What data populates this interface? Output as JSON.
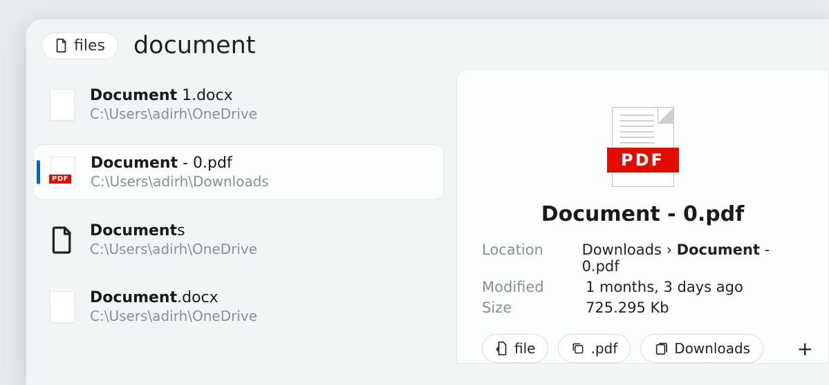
{
  "header": {
    "files_label": "files",
    "search_query": "document"
  },
  "results": [
    {
      "icon": "doc",
      "title_prefix": "Document",
      "title_suffix": " 1.docx",
      "path": "C:\\Users\\adirh\\OneDrive",
      "selected": false
    },
    {
      "icon": "pdf",
      "title_prefix": "Document",
      "title_suffix": " - 0.pdf",
      "path": "C:\\Users\\adirh\\Downloads",
      "selected": true
    },
    {
      "icon": "folder-file",
      "title_prefix": "Document",
      "title_suffix": "s",
      "path": "C:\\Users\\adirh\\OneDrive",
      "selected": false
    },
    {
      "icon": "doc",
      "title_prefix": "Document",
      "title_suffix": ".docx",
      "path": "C:\\Users\\adirh\\OneDrive",
      "selected": false
    }
  ],
  "preview": {
    "filename": "Document - 0.pdf",
    "meta": {
      "location_label": "Location",
      "location_prefix": "Downloads › ",
      "location_bold": "Document",
      "location_suffix": " - 0.pdf",
      "modified_label": "Modified",
      "modified_value": "1 months, 3 days ago",
      "size_label": "Size",
      "size_value": "725.295 Kb"
    },
    "chips": {
      "file": "file",
      "pdf": ".pdf",
      "downloads": "Downloads"
    },
    "pdf_band": "PDF"
  }
}
